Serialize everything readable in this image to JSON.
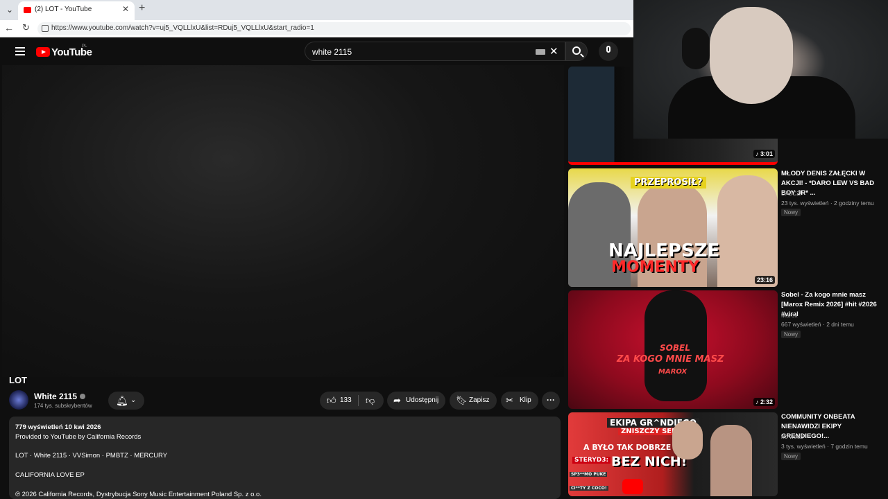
{
  "browser": {
    "tab_title": "(2) LOT - YouTube",
    "url": "https://www.youtube.com/watch?v=uj5_VQLLlxU&list=RDuj5_VQLLlxU&start_radio=1"
  },
  "header": {
    "logo_text": "YouTube",
    "region": "PL",
    "search_value": "white 2115"
  },
  "video": {
    "title": "LOT",
    "channel": "White 2115",
    "subscribers": "174 tys. subskrybentów",
    "likes": "133",
    "share_label": "Udostępnij",
    "save_label": "Zapisz",
    "clip_label": "Klip",
    "more_label": "···",
    "description": {
      "views_date": "779 wyświetleń  10 kwi 2026",
      "provided": "Provided to YouTube by California Records",
      "credits": "LOT · White 2115 · VVSimon · PMBTZ · MERCURY",
      "album": "CALIFORNIA LOVE EP",
      "copyright": "℗ 2026 California Records, Dystrybucja Sony Music Entertainment Poland Sp. z o.o."
    }
  },
  "recommendations": [
    {
      "duration": "3:01"
    },
    {
      "title": "MŁODY DENIS ZAŁĘCKI W AKCJI! - *DARO LEW VS BAD BOY JR* ...",
      "channel": "DAJCZI",
      "meta": "23 tys. wyświetleń · 2 godziny temu",
      "badge": "Nowy",
      "duration": "23:16",
      "thumb_top": "PRZEPROSIŁ?",
      "thumb_bottom1": "NAJLEPSZE",
      "thumb_bottom2": "MOMENTY"
    },
    {
      "title": "Sobel - Za kogo mnie masz [Marox Remix 2026] #hit #2026 #viral",
      "channel": "Marox",
      "meta": "667 wyświetleń · 2 dni temu",
      "badge": "Nowy",
      "duration": "2:32",
      "thumb_line1": "SOBEL",
      "thumb_line2": "ZA KOGO MNIE MASZ",
      "thumb_line3": "MAROX"
    },
    {
      "title": "COMMUNITY ONBEATA NIENAWIDZI EKIPY GRENDIEGO!...",
      "channel": "no weeż",
      "meta": "3 tys. wyświetleń · 7 godzin temu",
      "badge": "Nowy",
      "thumb_line1": "EKIPA GR^NDIEGO",
      "thumb_line2": "ZNISZCZY SERWER!",
      "thumb_line3": "A BYŁO TAK DOBRZE",
      "thumb_line4": "BEZ NICH!",
      "thumb_line5": "STERYD3:",
      "thumb_line6": "SP3**MO PUKE",
      "thumb_line7": "CI**TY Z COCO!"
    }
  ],
  "colors": {
    "accent": "#ff0000",
    "bg": "#0f0f0f",
    "pill": "#272727"
  }
}
